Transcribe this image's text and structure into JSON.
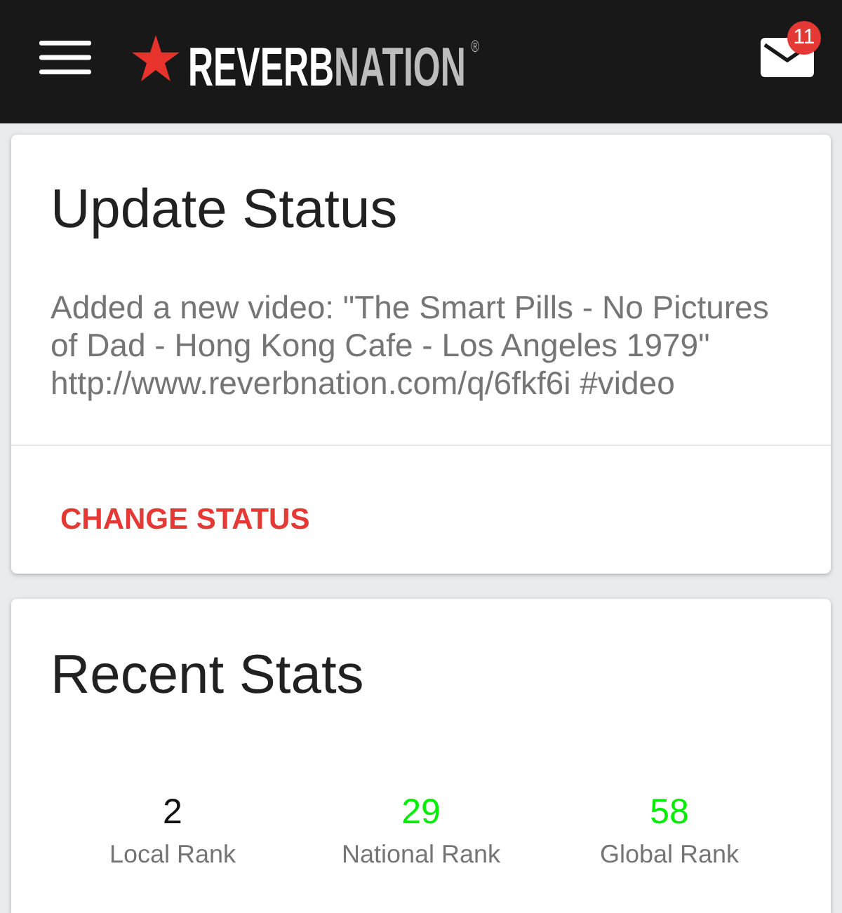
{
  "header": {
    "logo": {
      "first": "REVERB",
      "second": "NATION",
      "mark": "®"
    },
    "messages": {
      "badge": "11"
    }
  },
  "status_card": {
    "title": "Update Status",
    "status_text": "Added a new video: \"The Smart Pills - No Pictures of Dad - Hong Kong Cafe - Los Angeles 1979\" http://www.reverbnation.com/q/6fkf6i #video",
    "action": "CHANGE STATUS"
  },
  "stats_card": {
    "title": "Recent Stats",
    "stats": [
      {
        "value": "2",
        "label": "Local Rank",
        "color": "#111111"
      },
      {
        "value": "29",
        "label": "National Rank",
        "color": "#00ee00"
      },
      {
        "value": "58",
        "label": "Global Rank",
        "color": "#00ee00"
      }
    ]
  }
}
